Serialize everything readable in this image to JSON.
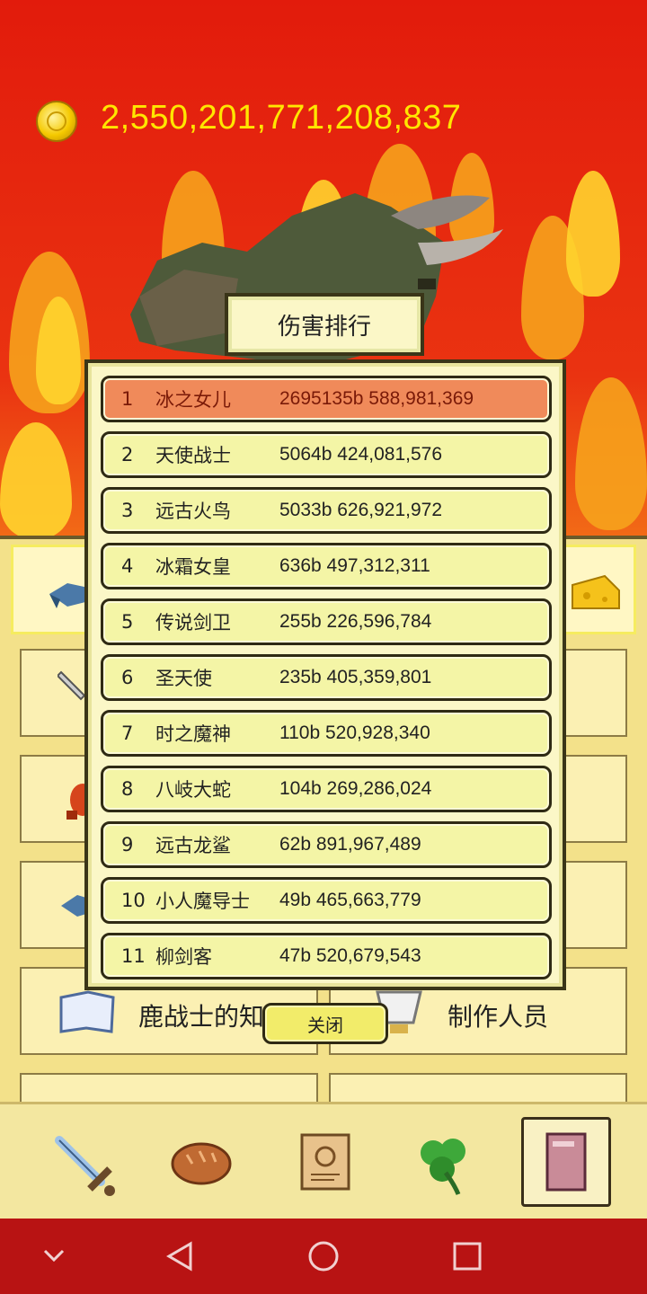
{
  "currency": {
    "amount": "2,550,201,771,208,837",
    "icon": "gold-coin-icon"
  },
  "dialog": {
    "title": "伤害排行",
    "close_label": "关闭",
    "rows": [
      {
        "rank": "1",
        "name": "冰之女儿",
        "score": "2695135b 588,981,369"
      },
      {
        "rank": "2",
        "name": "天使战士",
        "score": "5064b 424,081,576"
      },
      {
        "rank": "3",
        "name": "远古火鸟",
        "score": "5033b 626,921,972"
      },
      {
        "rank": "4",
        "name": "冰霜女皇",
        "score": "636b 497,312,311"
      },
      {
        "rank": "5",
        "name": "传说剑卫",
        "score": "255b 226,596,784"
      },
      {
        "rank": "6",
        "name": "圣天使",
        "score": "235b 405,359,801"
      },
      {
        "rank": "7",
        "name": "时之魔神",
        "score": "110b 520,928,340"
      },
      {
        "rank": "8",
        "name": "八岐大蛇",
        "score": "104b 269,286,024"
      },
      {
        "rank": "9",
        "name": "远古龙鲨",
        "score": "62b 891,967,489"
      },
      {
        "rank": "10",
        "name": "小人魔导士",
        "score": "49b 465,663,779"
      },
      {
        "rank": "11",
        "name": "柳剑客",
        "score": "47b 520,679,543"
      }
    ]
  },
  "background_menu": {
    "deer_warrior_label": "鹿战士的知识",
    "credits_label": "制作人员"
  },
  "tabs": [
    {
      "icon": "sword-icon"
    },
    {
      "icon": "bread-icon"
    },
    {
      "icon": "scroll-icon"
    },
    {
      "icon": "clover-icon"
    },
    {
      "icon": "book-icon",
      "selected": true
    }
  ],
  "navbar": [
    "chevron-down-icon",
    "back-triangle-icon",
    "home-circle-icon",
    "recents-square-icon"
  ],
  "colors": {
    "highlight_row": "#f08a5a",
    "row_bg": "#f4f5a6",
    "gold_text": "#ffe600"
  }
}
